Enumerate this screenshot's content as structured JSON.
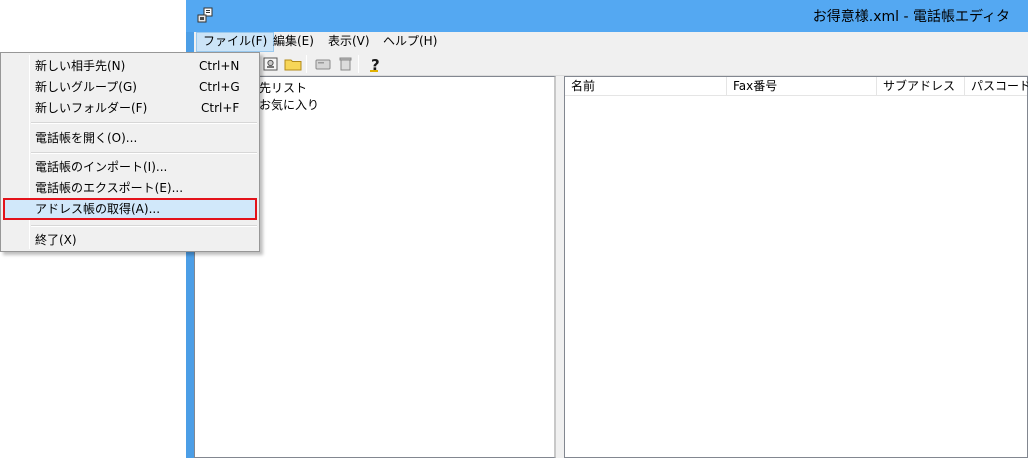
{
  "window": {
    "title": "お得意様.xml - 電話帳エディタ"
  },
  "menubar": {
    "items": [
      {
        "label": "ファイル(F)"
      },
      {
        "label": "編集(E)"
      },
      {
        "label": "表示(V)"
      },
      {
        "label": "ヘルプ(H)"
      }
    ]
  },
  "toolbar": {
    "buttons": [
      "address-book-icon",
      "folder-icon",
      "card-icon",
      "trash-icon",
      "help-icon"
    ]
  },
  "tree": {
    "items": [
      {
        "label": "先リスト"
      },
      {
        "label": "お気に入り"
      }
    ]
  },
  "list": {
    "columns": [
      {
        "label": "名前"
      },
      {
        "label": "Fax番号"
      },
      {
        "label": "サブアドレス"
      },
      {
        "label": "パスコード"
      }
    ]
  },
  "file_menu": {
    "items": [
      {
        "label": "新しい相手先(N)",
        "shortcut": "Ctrl+N"
      },
      {
        "label": "新しいグループ(G)",
        "shortcut": "Ctrl+G"
      },
      {
        "label": "新しいフォルダー(F)",
        "shortcut": "Ctrl+F"
      },
      {
        "label": "電話帳を開く(O)..."
      },
      {
        "label": "電話帳のインポート(I)..."
      },
      {
        "label": "電話帳のエクスポート(E)..."
      },
      {
        "label": "アドレス帳の取得(A)..."
      },
      {
        "label": "終了(X)"
      }
    ]
  },
  "colors": {
    "titlebar": "#54a8f2",
    "highlight_border": "#e3131b",
    "menu_hover": "#d1e8fa"
  }
}
